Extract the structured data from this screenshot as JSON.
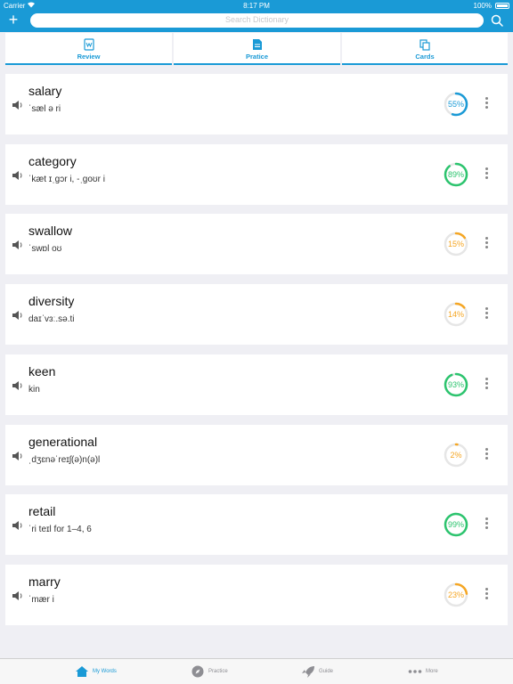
{
  "status_bar": {
    "carrier": "Carrier",
    "time": "8:17 PM",
    "battery": "100%"
  },
  "header": {
    "add_icon": "plus-icon",
    "search_placeholder": "Search Dictionary",
    "search_icon": "search-icon"
  },
  "tabs": [
    {
      "label": "Review",
      "icon": "document-icon"
    },
    {
      "label": "Pratice",
      "icon": "document-lines-icon"
    },
    {
      "label": "Cards",
      "icon": "cards-icon"
    }
  ],
  "words": [
    {
      "word": "salary",
      "phonetic": "ˈsæl ə ri",
      "progress_text": "55%",
      "progress": 0.55,
      "color": "#1a9ad6"
    },
    {
      "word": "category",
      "phonetic": "ˈkæt ɪˌgɔr i, -ˌgoʊr i",
      "progress_text": "89%",
      "progress": 0.89,
      "color": "#2cc46e"
    },
    {
      "word": "swallow",
      "phonetic": "ˈswɒl oʊ",
      "progress_text": "15%",
      "progress": 0.15,
      "color": "#f5a623"
    },
    {
      "word": "diversity",
      "phonetic": "daɪˈvɜː.sə.ti",
      "progress_text": "14%",
      "progress": 0.14,
      "color": "#f5a623"
    },
    {
      "word": "keen",
      "phonetic": "kin",
      "progress_text": "93%",
      "progress": 0.93,
      "color": "#2cc46e"
    },
    {
      "word": "generational",
      "phonetic": "ˌdʒɛnəˈreɪʃ(ə)n(ə)l",
      "progress_text": "2%",
      "progress": 0.02,
      "color": "#f5a623"
    },
    {
      "word": "retail",
      "phonetic": "ˈri teɪl for 1–4, 6",
      "progress_text": "99%",
      "progress": 0.99,
      "color": "#2cc46e"
    },
    {
      "word": "marry",
      "phonetic": "ˈmær i",
      "progress_text": "23%",
      "progress": 0.23,
      "color": "#f5a623"
    }
  ],
  "tabbar": [
    {
      "label": "My Words",
      "icon": "home-icon",
      "active": true
    },
    {
      "label": "Practice",
      "icon": "compass-icon",
      "active": false
    },
    {
      "label": "Guide",
      "icon": "rocket-icon",
      "active": false
    },
    {
      "label": "More",
      "icon": "more-icon",
      "active": false
    }
  ],
  "colors": {
    "accent": "#1a9ad6",
    "green": "#2cc46e",
    "orange": "#f5a623"
  }
}
